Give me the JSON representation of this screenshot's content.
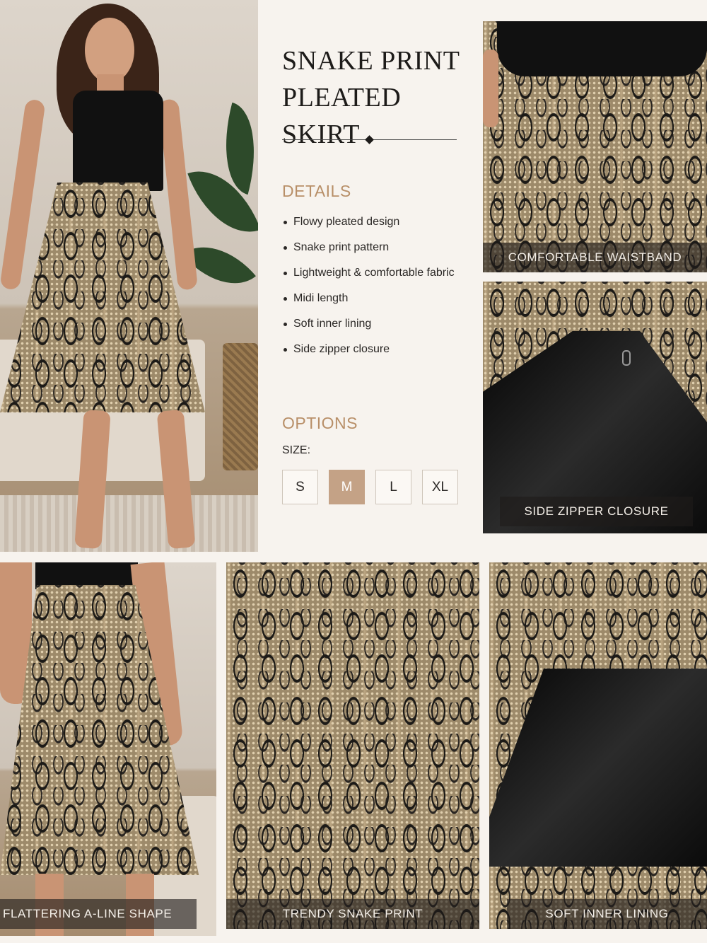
{
  "product": {
    "title_line1": "SNAKE PRINT",
    "title_line2": "PLEATED SKIRT"
  },
  "details": {
    "heading": "DETAILS",
    "items": [
      "Flowy pleated design",
      "Snake print pattern",
      "Lightweight & comfortable fabric",
      "Midi length",
      "Soft inner lining",
      "Side zipper closure"
    ]
  },
  "options": {
    "heading": "OPTIONS",
    "size_label": "SIZE:",
    "sizes": [
      "S",
      "M",
      "L",
      "XL"
    ],
    "selected_size": "M"
  },
  "captions": {
    "waistband": "COMFORTABLE WAISTBAND",
    "zipper": "SIDE ZIPPER CLOSURE",
    "aline": "FLATTERING A-LINE SHAPE",
    "print": "TRENDY SNAKE PRINT",
    "lining": "SOFT INNER LINING"
  },
  "colors": {
    "accent": "#b88f68",
    "selected_size_bg": "#c4a286",
    "background": "#f7f3ee"
  }
}
